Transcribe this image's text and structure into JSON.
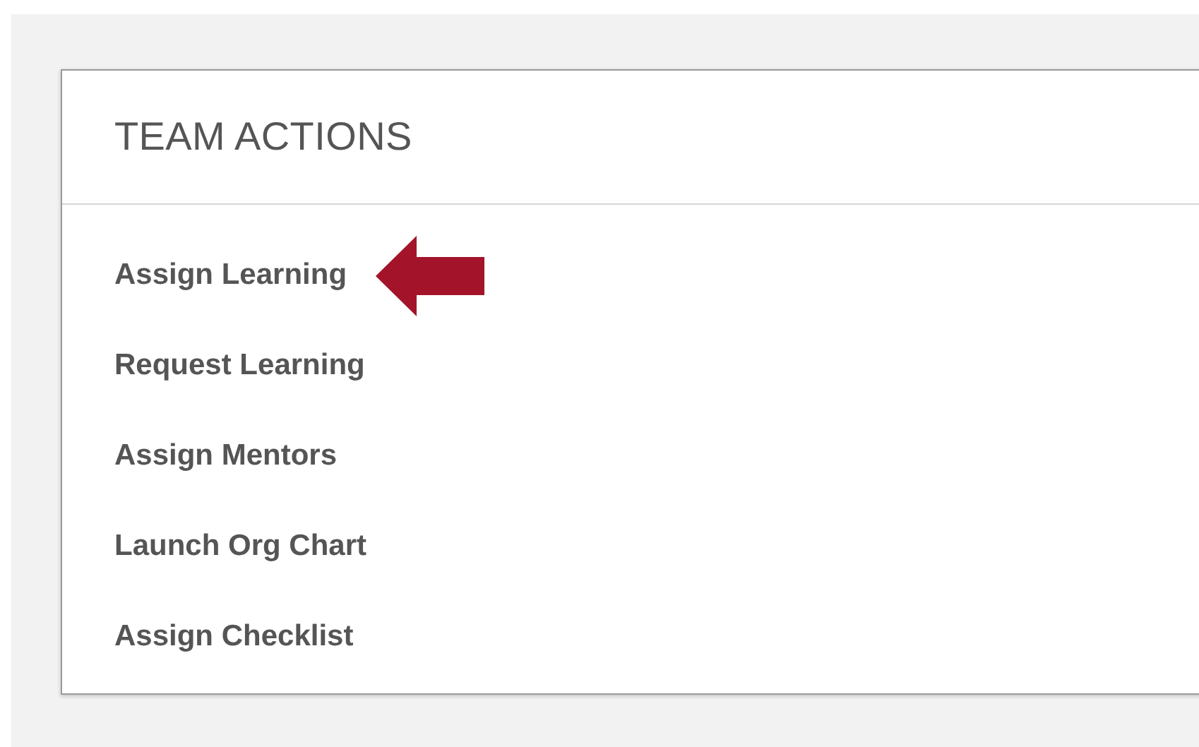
{
  "card": {
    "title": "TEAM ACTIONS",
    "actions": [
      {
        "label": "Assign Learning",
        "highlighted": true
      },
      {
        "label": "Request Learning",
        "highlighted": false
      },
      {
        "label": "Assign Mentors",
        "highlighted": false
      },
      {
        "label": "Launch Org Chart",
        "highlighted": false
      },
      {
        "label": "Assign Checklist",
        "highlighted": false
      }
    ]
  }
}
